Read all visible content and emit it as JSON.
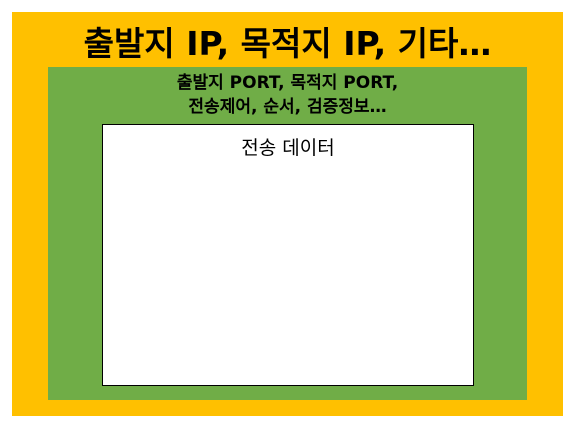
{
  "layers": {
    "ip": {
      "label": "출발지 IP, 목적지 IP, 기타…",
      "color": "#ffc000"
    },
    "transport": {
      "label_line1": "출발지 PORT, 목적지 PORT,",
      "label_line2": "전송제어, 순서, 검증정보…",
      "color": "#70ad47"
    },
    "payload": {
      "label": "전송 데이터",
      "color": "#ffffff"
    }
  }
}
